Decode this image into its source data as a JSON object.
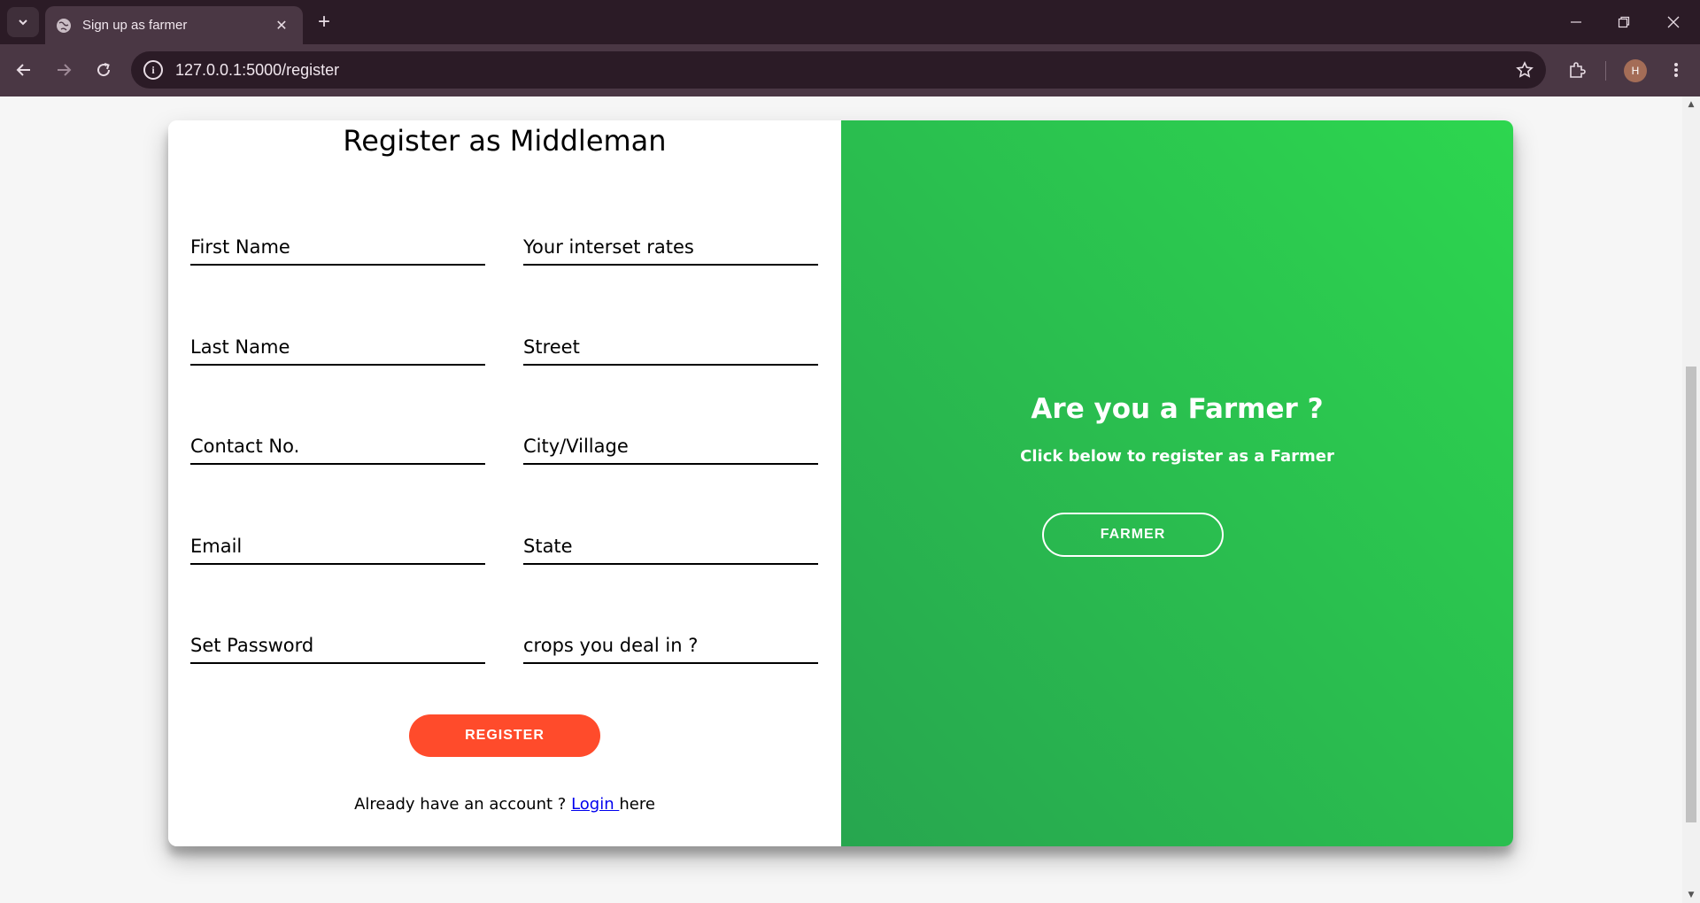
{
  "browser": {
    "tab_title": "Sign up as farmer",
    "url": "127.0.0.1:5000/register",
    "profile_initial": "H"
  },
  "form": {
    "title": "Register as Middleman",
    "left_fields": [
      "First Name",
      "Last Name",
      "Contact No.",
      "Email",
      "Set Password"
    ],
    "right_fields": [
      "Your interset rates",
      "Street",
      "City/Village",
      "State",
      "crops you deal in ?"
    ],
    "register_label": "REGISTER",
    "login_prefix": "Already have an account ? ",
    "login_link": "Login ",
    "login_suffix": "here"
  },
  "overlay": {
    "title": "Are you a Farmer ?",
    "subtitle": "Click below to register as a Farmer",
    "button_label": "FARMER"
  },
  "colors": {
    "register_button": "#ff4b2b",
    "overlay_gradient_start": "#2dd64f",
    "overlay_gradient_end": "#27a64f"
  }
}
